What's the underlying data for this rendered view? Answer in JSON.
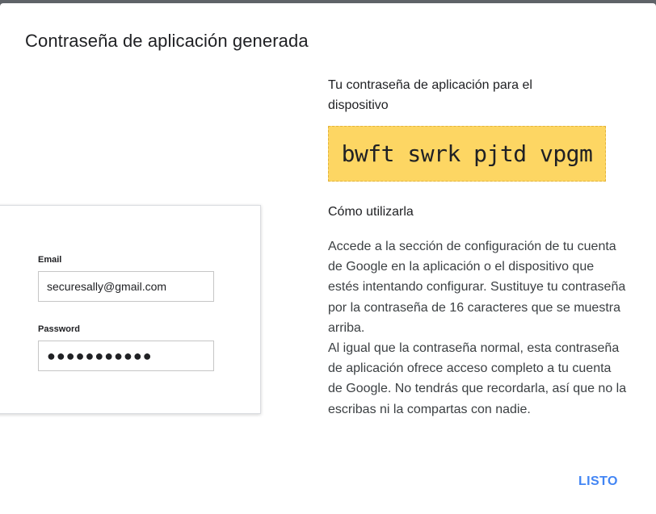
{
  "dialog": {
    "title": "Contraseña de aplicación generada"
  },
  "illustration": {
    "email_label": "Email",
    "email_value": "securesally@gmail.com",
    "password_label": "Password",
    "password_value": "●●●●●●●●●●●"
  },
  "password_section": {
    "heading": "Tu contraseña de aplicación para el dispositivo",
    "app_password": "bwft swrk pjtd vpgm",
    "box_color": "#fdd663"
  },
  "how_to_use": {
    "heading": "Cómo utilizarla",
    "paragraph_1": "Accede a la sección de configuración de tu cuenta de Google en la aplicación o el dispositivo que estés intentando configurar. Sustituye tu contraseña por la contraseña de 16 caracteres que se muestra arriba.",
    "paragraph_2": "Al igual que la contraseña normal, esta contraseña de aplicación ofrece acceso completo a tu cuenta de Google. No tendrás que recordarla, así que no la escribas ni la compartas con nadie."
  },
  "actions": {
    "done_label": "LISTO",
    "accent_color": "#4285f4"
  }
}
